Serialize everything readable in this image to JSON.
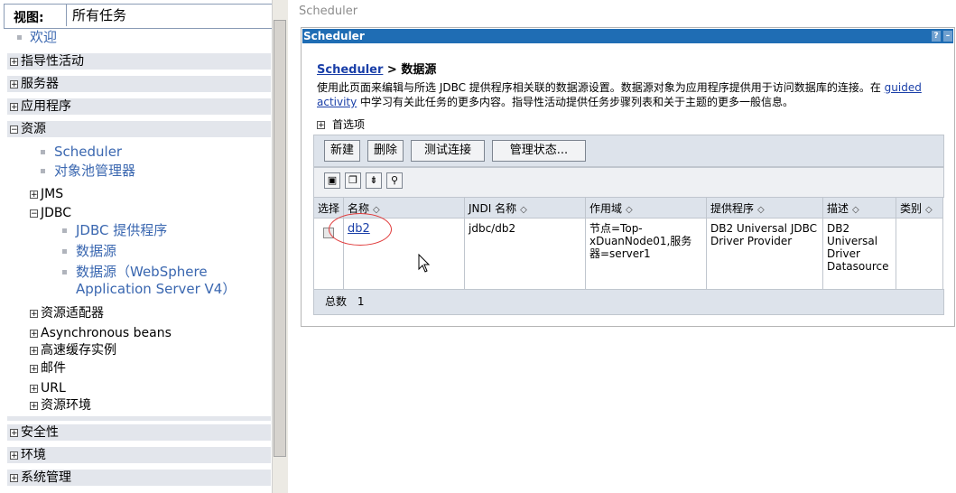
{
  "nav": {
    "view_label": "视图:",
    "view_value": "所有任务",
    "welcome": "欢迎",
    "sections": {
      "guided": "指导性活动",
      "servers": "服务器",
      "applications": "应用程序",
      "resources": "资源",
      "security": "安全性",
      "environment": "环境",
      "system_admin": "系统管理"
    },
    "resources": {
      "scheduler": "Scheduler",
      "object_pool": "对象池管理器",
      "jms": "JMS",
      "jdbc": "JDBC",
      "jdbc_provider": "JDBC 提供程序",
      "datasource": "数据源",
      "datasource_v4_line1": "数据源（WebSphere",
      "datasource_v4_line2": "Application Server V4）",
      "resource_adapter": "资源适配器",
      "async_beans": "Asynchronous beans",
      "cache": "高速缓存实例",
      "mail": "邮件",
      "url": "URL",
      "res_env": "资源环境"
    },
    "expanded_symbol": "⊟",
    "collapsed_symbol": "⊞"
  },
  "main": {
    "top_crumb": "Scheduler",
    "panel_title": "Scheduler",
    "help_btn": "?",
    "min_btn": "–",
    "breadcrumb_link": "Scheduler",
    "breadcrumb_rest": " > 数据源",
    "desc_part1": "使用此页面来编辑与所选 JDBC 提供程序相关联的数据源设置。数据源对象为应用程序提供用于访问数据库的连接。在 ",
    "desc_link": "guided activity",
    "desc_part2": " 中学习有关此任务的更多内容。指导性活动提供任务步骤列表和关于主题的更多一般信息。",
    "prefs": "首选项",
    "buttons": {
      "new": "新建",
      "delete": "删除",
      "test": "测试连接",
      "manage": "管理状态..."
    },
    "columns": [
      "选择",
      "名称",
      "JNDI 名称",
      "作用域",
      "提供程序",
      "描述",
      "类别"
    ],
    "rows": [
      {
        "name": "db2",
        "jndi": "jdbc/db2",
        "scope": "节点=Top-xDuanNode01,服务器=server1",
        "provider": "DB2 Universal JDBC Driver Provider",
        "description": "DB2 Universal Driver Datasource",
        "category": ""
      }
    ],
    "total_label": "总数",
    "total_count": "1"
  },
  "colors": {
    "title_bar": "#1f6db4",
    "link": "#1a3fa8",
    "nav_link": "#3a67b0",
    "section_bg": "#e3e6ec",
    "annotation_circle": "#e03a3a"
  }
}
